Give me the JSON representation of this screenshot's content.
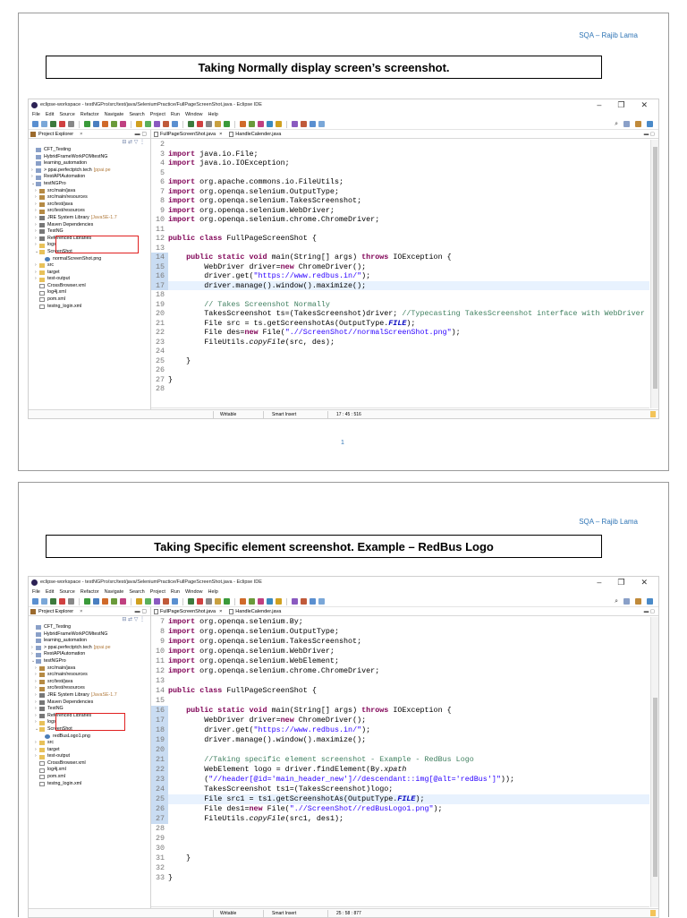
{
  "author": "SQA – Rajib Lama",
  "page_number": "1",
  "slides": [
    {
      "title": "Taking Normally display screen’s screenshot.",
      "ide": {
        "window_title": "eclipse-workspace - testNGPro/src/test/java/SeleniumPractice/FullPageScreenShot.java - Eclipse IDE",
        "menu": [
          "File",
          "Edit",
          "Source",
          "Refactor",
          "Navigate",
          "Search",
          "Project",
          "Run",
          "Window",
          "Help"
        ],
        "explorer_title": "Project Explorer",
        "tree": [
          {
            "label": "CFT_Testing",
            "icon": "project-icon",
            "arrow": ""
          },
          {
            "label": "HybridFrameWorkPOMtestNG",
            "icon": "project-icon",
            "arrow": ""
          },
          {
            "label": "learning_automation",
            "icon": "project-icon",
            "arrow": ""
          },
          {
            "label": "> ppai.perfectptch.tech",
            "annotation": "[ppai.pe",
            "icon": "project-icon",
            "arrow": ">"
          },
          {
            "label": "RestAPIAutomation",
            "icon": "project-icon",
            "arrow": ">"
          },
          {
            "label": "testNGPro",
            "icon": "project-icon",
            "arrow": "v"
          },
          {
            "label": "src/main/java",
            "icon": "package-icon",
            "arrow": ">"
          },
          {
            "label": "src/main/resources",
            "icon": "package-icon",
            "arrow": ">"
          },
          {
            "label": "src/test/java",
            "icon": "package-icon",
            "arrow": ">"
          },
          {
            "label": "src/test/resources",
            "icon": "package-icon",
            "arrow": ">"
          },
          {
            "label": "JRE System Library",
            "annotation": "[JavaSE-1.7",
            "icon": "library-icon",
            "arrow": ">"
          },
          {
            "label": "Maven Dependencies",
            "icon": "library-icon",
            "arrow": ">"
          },
          {
            "label": "TestNG",
            "icon": "library-icon",
            "arrow": ">"
          },
          {
            "label": "Referenced Libraries",
            "icon": "library-icon",
            "arrow": ">"
          },
          {
            "label": "logs",
            "icon": "folder-icon",
            "arrow": ">"
          },
          {
            "label": "ScreenShot",
            "icon": "folder-icon",
            "arrow": "v"
          },
          {
            "label": "normalScreenShot.png",
            "icon": "image-file-icon",
            "arrow": "",
            "indent": 1
          },
          {
            "label": "src",
            "icon": "folder-icon",
            "arrow": ">"
          },
          {
            "label": "target",
            "icon": "folder-icon",
            "arrow": ">"
          },
          {
            "label": "test-output",
            "icon": "folder-icon",
            "arrow": ">"
          },
          {
            "label": "CrossBrowser.xml",
            "icon": "file-icon",
            "arrow": ""
          },
          {
            "label": "log4j.xml",
            "icon": "file-icon",
            "arrow": ""
          },
          {
            "label": "pom.xml",
            "icon": "file-icon",
            "arrow": ""
          },
          {
            "label": "testng_login.xml",
            "icon": "file-icon",
            "arrow": ""
          }
        ],
        "tabs": [
          "FullPageScreenShot.java",
          "HandleCalender.java"
        ],
        "code": [
          {
            "n": "2",
            "t": ""
          },
          {
            "n": "3",
            "t": "import java.io.File;"
          },
          {
            "n": "4",
            "t": "import java.io.IOException;"
          },
          {
            "n": "5",
            "t": ""
          },
          {
            "n": "6",
            "t": "import org.apache.commons.io.FileUtils;"
          },
          {
            "n": "7",
            "t": "import org.openqa.selenium.OutputType;"
          },
          {
            "n": "8",
            "t": "import org.openqa.selenium.TakesScreenshot;"
          },
          {
            "n": "9",
            "t": "import org.openqa.selenium.WebDriver;"
          },
          {
            "n": "10",
            "t": "import org.openqa.selenium.chrome.ChromeDriver;"
          },
          {
            "n": "11",
            "t": ""
          },
          {
            "n": "12",
            "t": "public class FullPageScreenShot {"
          },
          {
            "n": "13",
            "t": ""
          },
          {
            "n": "14",
            "t": "    public static void main(String[] args) throws IOException {"
          },
          {
            "n": "15",
            "t": "        WebDriver driver=new ChromeDriver();"
          },
          {
            "n": "16",
            "t": "        driver.get(\"https://www.redbus.in/\");"
          },
          {
            "n": "17",
            "t": "        driver.manage().window().maximize();"
          },
          {
            "n": "18",
            "t": ""
          },
          {
            "n": "19",
            "t": "        // Takes Screenshot Normally"
          },
          {
            "n": "20",
            "t": "        TakesScreenshot ts=(TakesScreenshot)driver; //Typecasting TakesScreenshot interface with WebDriver"
          },
          {
            "n": "21",
            "t": "        File src = ts.getScreenshotAs(OutputType.FILE);"
          },
          {
            "n": "22",
            "t": "        File des=new File(\".//ScreenShot//normalScreenShot.png\");"
          },
          {
            "n": "23",
            "t": "        FileUtils.copyFile(src, des);"
          },
          {
            "n": "24",
            "t": ""
          },
          {
            "n": "25",
            "t": "    }"
          },
          {
            "n": "26",
            "t": ""
          },
          {
            "n": "27",
            "t": "}"
          },
          {
            "n": "28",
            "t": ""
          }
        ],
        "status": {
          "mode": "Writable",
          "insert": "Smart Insert",
          "position": "17 : 45 : 516"
        }
      }
    },
    {
      "title": "Taking Specific element screenshot. Example – RedBus Logo",
      "ide": {
        "window_title": "eclipse-workspace - testNGPro/src/test/java/SeleniumPractice/FullPageScreenShot.java - Eclipse IDE",
        "menu": [
          "File",
          "Edit",
          "Source",
          "Refactor",
          "Navigate",
          "Search",
          "Project",
          "Run",
          "Window",
          "Help"
        ],
        "explorer_title": "Project Explorer",
        "tree": [
          {
            "label": "CFT_Testing",
            "icon": "project-icon",
            "arrow": ""
          },
          {
            "label": "HybridFrameWorkPOMtestNG",
            "icon": "project-icon",
            "arrow": ""
          },
          {
            "label": "learning_automation",
            "icon": "project-icon",
            "arrow": ""
          },
          {
            "label": "> ppai.perfectptch.tech",
            "annotation": "[ppai.pe",
            "icon": "project-icon",
            "arrow": ">"
          },
          {
            "label": "RestAPIAutomation",
            "icon": "project-icon",
            "arrow": ">"
          },
          {
            "label": "testNGPro",
            "icon": "project-icon",
            "arrow": "v"
          },
          {
            "label": "src/main/java",
            "icon": "package-icon",
            "arrow": ">"
          },
          {
            "label": "src/main/resources",
            "icon": "package-icon",
            "arrow": ">"
          },
          {
            "label": "src/test/java",
            "icon": "package-icon",
            "arrow": ">"
          },
          {
            "label": "src/test/resources",
            "icon": "package-icon",
            "arrow": ">"
          },
          {
            "label": "JRE System Library",
            "annotation": "[JavaSE-1.7",
            "icon": "library-icon",
            "arrow": ">"
          },
          {
            "label": "Maven Dependencies",
            "icon": "library-icon",
            "arrow": ">"
          },
          {
            "label": "TestNG",
            "icon": "library-icon",
            "arrow": ">"
          },
          {
            "label": "Referenced Libraries",
            "icon": "library-icon",
            "arrow": ">"
          },
          {
            "label": "logs",
            "icon": "folder-icon",
            "arrow": ">"
          },
          {
            "label": "ScreenShot",
            "icon": "folder-icon",
            "arrow": "v"
          },
          {
            "label": "redBusLogo1.png",
            "icon": "image-file-icon",
            "arrow": "",
            "indent": 1
          },
          {
            "label": "src",
            "icon": "folder-icon",
            "arrow": ">"
          },
          {
            "label": "target",
            "icon": "folder-icon",
            "arrow": ">"
          },
          {
            "label": "test-output",
            "icon": "folder-icon",
            "arrow": ">"
          },
          {
            "label": "CrossBrowser.xml",
            "icon": "file-icon",
            "arrow": ""
          },
          {
            "label": "log4j.xml",
            "icon": "file-icon",
            "arrow": ""
          },
          {
            "label": "pom.xml",
            "icon": "file-icon",
            "arrow": ""
          },
          {
            "label": "testng_login.xml",
            "icon": "file-icon",
            "arrow": ""
          }
        ],
        "tabs": [
          "FullPageScreenShot.java",
          "HandleCalender.java"
        ],
        "code": [
          {
            "n": "7",
            "t": "import org.openqa.selenium.By;"
          },
          {
            "n": "8",
            "t": "import org.openqa.selenium.OutputType;"
          },
          {
            "n": "9",
            "t": "import org.openqa.selenium.TakesScreenshot;"
          },
          {
            "n": "10",
            "t": "import org.openqa.selenium.WebDriver;"
          },
          {
            "n": "11",
            "t": "import org.openqa.selenium.WebElement;"
          },
          {
            "n": "12",
            "t": "import org.openqa.selenium.chrome.ChromeDriver;"
          },
          {
            "n": "13",
            "t": ""
          },
          {
            "n": "14",
            "t": "public class FullPageScreenShot {"
          },
          {
            "n": "15",
            "t": ""
          },
          {
            "n": "16",
            "t": "    public static void main(String[] args) throws IOException {"
          },
          {
            "n": "17",
            "t": "        WebDriver driver=new ChromeDriver();"
          },
          {
            "n": "18",
            "t": "        driver.get(\"https://www.redbus.in/\");"
          },
          {
            "n": "19",
            "t": "        driver.manage().window().maximize();"
          },
          {
            "n": "20",
            "t": ""
          },
          {
            "n": "21",
            "t": "        //Taking specific element screenshot - Example - RedBus Logo"
          },
          {
            "n": "22",
            "t": "        WebElement logo = driver.findElement(By.xpath"
          },
          {
            "n": "23",
            "t": "        (\"//header[@id='main_header_new']//descendant::img[@alt='redBus']\"));"
          },
          {
            "n": "24",
            "t": "        TakesScreenshot ts1=(TakesScreenshot)logo;"
          },
          {
            "n": "25",
            "t": "        File src1 = ts1.getScreenshotAs(OutputType.FILE);"
          },
          {
            "n": "26",
            "t": "        File des1=new File(\".//ScreenShot//redBusLogo1.png\");"
          },
          {
            "n": "27",
            "t": "        FileUtils.copyFile(src1, des1);"
          },
          {
            "n": "28",
            "t": ""
          },
          {
            "n": "29",
            "t": ""
          },
          {
            "n": "30",
            "t": ""
          },
          {
            "n": "31",
            "t": "    }"
          },
          {
            "n": "32",
            "t": ""
          },
          {
            "n": "33",
            "t": "}"
          }
        ],
        "status": {
          "mode": "Writable",
          "insert": "Smart Insert",
          "position": "25 : 58 : 877"
        }
      }
    }
  ],
  "colors": {
    "keyword": "#7f0055",
    "string": "#2a00ff",
    "comment": "#3f7f5f",
    "field": "#0000c0",
    "author": "#2e74b5",
    "highlight_box": "#e02020"
  }
}
